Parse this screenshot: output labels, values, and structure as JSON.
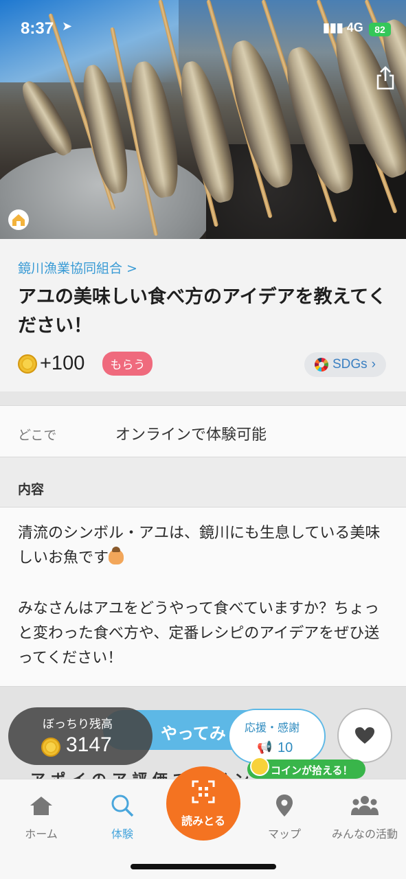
{
  "status_bar": {
    "time": "8:37",
    "signal": "4G",
    "battery": "82"
  },
  "post": {
    "organizer": "鏡川漁業協同組合 >",
    "title": "アユの美味しい食べ方のアイデアを教えてください！",
    "reward": "+100",
    "reward_badge": "もらう",
    "sdgs_label": "SDGs",
    "where_label": "どこで",
    "where_value": "オンラインで体験可能",
    "content_heading": "内容",
    "description_1": "清流のシンボル・アユは、鏡川にも生息している美味しいお魚です",
    "description_2": "みなさんはアユをどうやって食べていますか？ちょっと変わった食べ方や、定番レシピのアイデアをぜひ送ってください！",
    "lower_partial": "ア ポ イ の ア 評 価 で イ イ ン"
  },
  "action_bar": {
    "balance_label": "ぼっちり残高",
    "balance_value": "3147",
    "do_it_label": "やってみ",
    "support_label": "応援・感謝",
    "support_count": "10",
    "coin_pill": "コインが拾える！"
  },
  "tabs": [
    {
      "label": "ホーム",
      "icon": "home-icon"
    },
    {
      "label": "体験",
      "icon": "search-icon",
      "active": true
    },
    {
      "label": "読みとる",
      "icon": "qr-scan-icon"
    },
    {
      "label": "マップ",
      "icon": "map-pin-icon"
    },
    {
      "label": "みんなの活動",
      "icon": "people-icon"
    }
  ],
  "colors": {
    "accent": "#49a6dc",
    "scan": "#f47321",
    "badge": "#ef6a7d",
    "coin_pill": "#39b54a"
  }
}
